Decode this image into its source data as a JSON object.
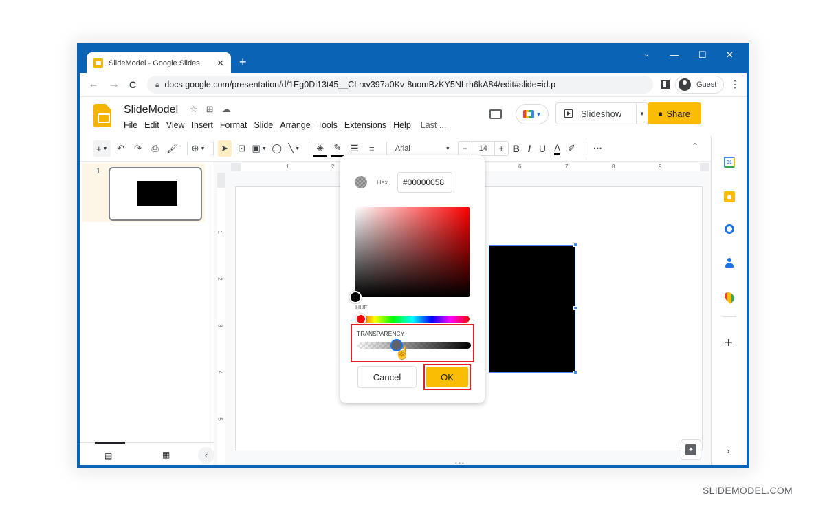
{
  "browser": {
    "tab_title": "SlideModel - Google Slides",
    "tab_close": "✕",
    "new_tab": "+",
    "window_controls": [
      "⌄",
      "—",
      "☐",
      "✕"
    ],
    "nav": {
      "back": "←",
      "forward": "→",
      "reload": "C"
    },
    "url": "docs.google.com/presentation/d/1Eg0Di13t45__CLrxv397a0Kv-8uomBzKY5NLrh6kA84/edit#slide=id.p",
    "profile_label": "Guest",
    "menu": "⋮"
  },
  "doc": {
    "title": "SlideModel",
    "title_icons": [
      "star-icon",
      "move-to-folder-icon",
      "cloud-status-icon"
    ],
    "menu": [
      "File",
      "Edit",
      "View",
      "Insert",
      "Format",
      "Slide",
      "Arrange",
      "Tools",
      "Extensions",
      "Help"
    ],
    "last_edit": "Last ..."
  },
  "header_actions": {
    "slideshow_label": "Slideshow",
    "share_label": "Share"
  },
  "toolbar": {
    "font": "Arial",
    "font_size": "14",
    "decrease": "−",
    "increase": "+",
    "bold": "B",
    "italic": "I",
    "underline": "U",
    "text_color": "A",
    "more": "⋯",
    "collapse": "⌃"
  },
  "filmstrip": {
    "slides": [
      {
        "number": "1"
      }
    ]
  },
  "rulers": {
    "horizontal": [
      "1",
      "2",
      "6",
      "7",
      "8",
      "9"
    ],
    "vertical": [
      "1",
      "2",
      "3",
      "4",
      "5"
    ]
  },
  "color_picker": {
    "hex_label": "Hex",
    "hex_value": "#00000058",
    "hue_label": "HUE",
    "transparency_label": "TRANSPARENCY",
    "transparency_percent": 35,
    "cancel_label": "Cancel",
    "ok_label": "OK",
    "colors": {
      "accent": "#fbbc04",
      "highlight_border": "#e02424",
      "selected_color": "#000000"
    }
  },
  "watermark": "SLIDEMODEL.COM"
}
